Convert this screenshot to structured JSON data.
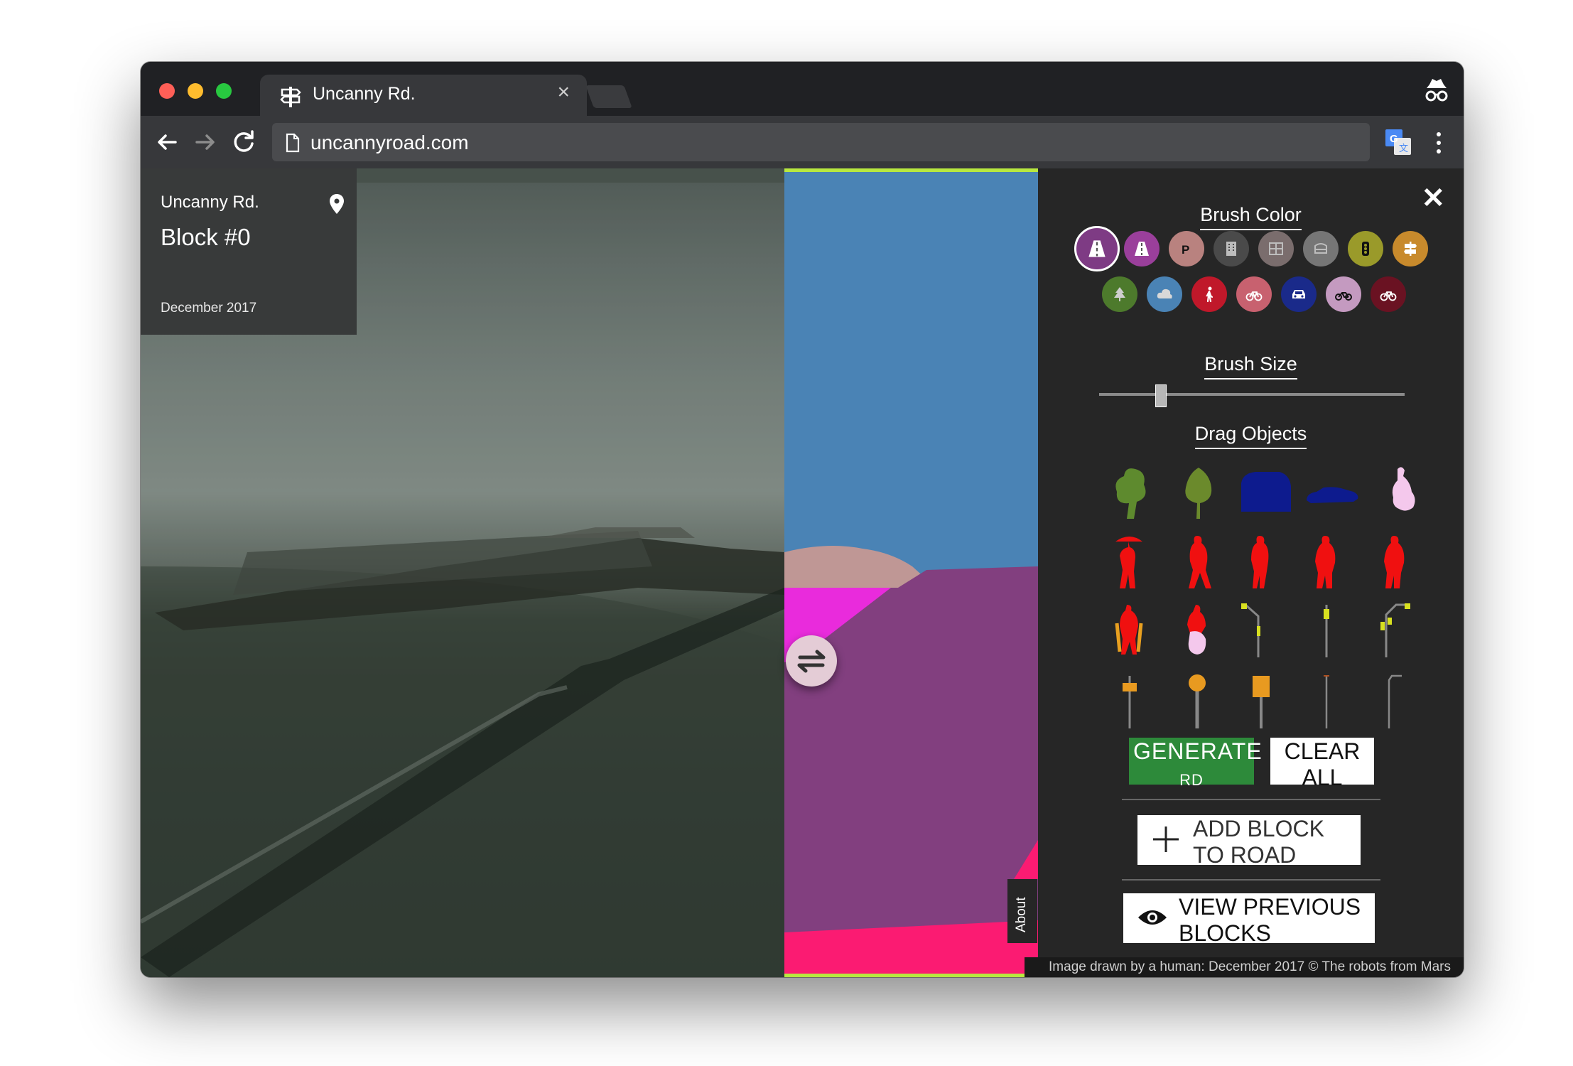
{
  "browser": {
    "tab_title": "Uncanny Rd.",
    "url": "uncannyroad.com"
  },
  "info": {
    "title": "Uncanny Rd.",
    "block": "Block #0",
    "date": "December 2017"
  },
  "panel": {
    "brush_color_heading": "Brush Color",
    "brush_size_heading": "Brush Size",
    "brush_size_value": 0.2,
    "drag_objects_heading": "Drag Objects",
    "generate_label": "Generate",
    "generate_suffix": "Rd",
    "clear_label": "Clear All",
    "add_block_label": "Add block to road",
    "view_previous_label": "View previous blocks",
    "about_label": "About"
  },
  "palette": [
    {
      "name": "road",
      "icon": "road-icon",
      "color": "#7e3b84",
      "selected": true
    },
    {
      "name": "sidewalk",
      "icon": "road-icon",
      "color": "#9a3f9b"
    },
    {
      "name": "parking",
      "icon": "parking-icon",
      "color": "#b9827f"
    },
    {
      "name": "building",
      "icon": "building-icon",
      "color": "#4a4a4a"
    },
    {
      "name": "wall",
      "icon": "wall-icon",
      "color": "#7a6d6d"
    },
    {
      "name": "fence",
      "icon": "fence-icon",
      "color": "#767676"
    },
    {
      "name": "traffic-light",
      "icon": "traffic-light-icon",
      "color": "#9a9a2a"
    },
    {
      "name": "traffic-sign",
      "icon": "signpost-icon",
      "color": "#c88a2c"
    },
    {
      "name": "vegetation",
      "icon": "tree-icon",
      "color": "#4d7a2c"
    },
    {
      "name": "sky",
      "icon": "cloud-icon",
      "color": "#4a83b5"
    },
    {
      "name": "person",
      "icon": "person-icon",
      "color": "#c0182a"
    },
    {
      "name": "rider",
      "icon": "bicycle-icon",
      "color": "#c8616f"
    },
    {
      "name": "car",
      "icon": "car-icon",
      "color": "#1a2a8a"
    },
    {
      "name": "motorcycle",
      "icon": "motorcycle-icon",
      "color": "#c49ac0"
    },
    {
      "name": "bicycle",
      "icon": "bicycle-icon",
      "color": "#6a1222"
    }
  ],
  "credits": "Image drawn by a human: December 2017 © The robots from Mars",
  "colors": {
    "generate_green": "#2d8a3a",
    "accent_lime": "#b8e840",
    "panel_bg": "#262626"
  }
}
